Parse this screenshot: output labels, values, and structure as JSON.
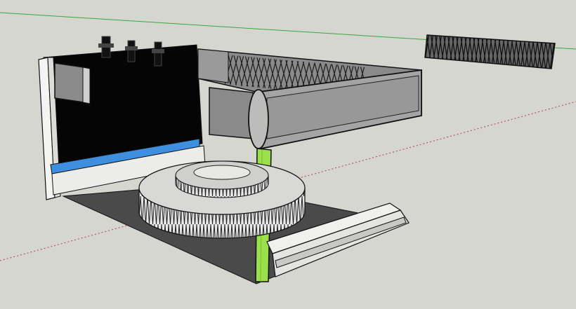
{
  "app": {
    "view": "3d-model-viewport"
  },
  "colors": {
    "background": "#d6d6d0",
    "green_axis": "#3aa83a",
    "red_axis": "#b84040",
    "blue_strip": "#3f8fe0",
    "green_post": "#9be04a",
    "shadow_floor": "#4a4a4a",
    "duct_face": "#8a8a8a",
    "light_face": "#ececea"
  },
  "icons": {
    "axis_green": "green-axis-line",
    "axis_red": "red-axis-line"
  }
}
